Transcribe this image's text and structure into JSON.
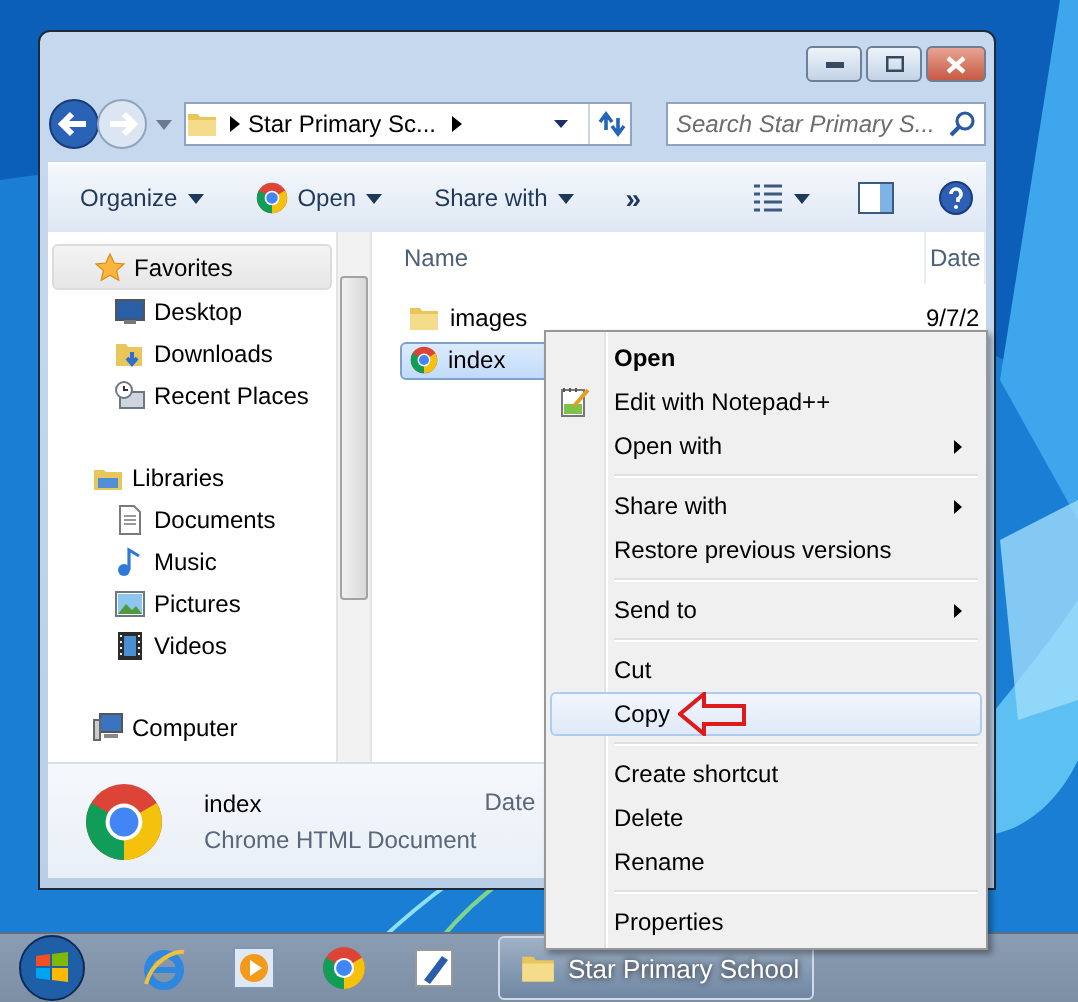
{
  "window": {
    "address": {
      "crumb": "Star Primary Sc..."
    },
    "search": {
      "placeholder": "Search Star Primary S..."
    },
    "toolbar": [
      {
        "label": "Organize",
        "kind": "menu"
      },
      {
        "label": "Open",
        "kind": "app-menu"
      },
      {
        "label": "Share with",
        "kind": "menu"
      },
      {
        "label": "»",
        "kind": "overflow"
      }
    ],
    "navigation": [
      {
        "label": "Favorites",
        "kind": "star",
        "selected": true,
        "children": [
          {
            "label": "Desktop",
            "kind": "desktop",
            "selected": false
          },
          {
            "label": "Downloads",
            "kind": "downloads",
            "selected": false
          },
          {
            "label": "Recent Places",
            "kind": "recent",
            "selected": false
          }
        ]
      },
      {
        "label": "Libraries",
        "kind": "library",
        "selected": false,
        "children": [
          {
            "label": "Documents",
            "kind": "document",
            "selected": false
          },
          {
            "label": "Music",
            "kind": "music",
            "selected": false
          },
          {
            "label": "Pictures",
            "kind": "pictures",
            "selected": false
          },
          {
            "label": "Videos",
            "kind": "videos",
            "selected": false
          }
        ]
      },
      {
        "label": "Computer",
        "kind": "computer",
        "selected": false
      }
    ],
    "columns": [
      "Name",
      "Date"
    ],
    "files": [
      {
        "name": "images",
        "kind": "folder",
        "date": "9/7/2",
        "selected": false
      },
      {
        "name": "index",
        "kind": "chrome",
        "selected": true
      }
    ],
    "details": {
      "name": "index",
      "type": "Chrome HTML Document",
      "field": "Date"
    }
  },
  "context_menu": [
    {
      "kind": "item",
      "label": "Open",
      "default": true,
      "icon": false,
      "submenu": false,
      "selected": false,
      "pointer_arrow": false
    },
    {
      "kind": "item",
      "label": "Edit with Notepad++",
      "default": false,
      "icon": true,
      "submenu": false,
      "selected": false,
      "pointer_arrow": false
    },
    {
      "kind": "item",
      "label": "Open with",
      "default": false,
      "icon": false,
      "submenu": true,
      "selected": false,
      "pointer_arrow": false
    },
    {
      "kind": "separator"
    },
    {
      "kind": "item",
      "label": "Share with",
      "default": false,
      "icon": false,
      "submenu": true,
      "selected": false,
      "pointer_arrow": false
    },
    {
      "kind": "item",
      "label": "Restore previous versions",
      "default": false,
      "icon": false,
      "submenu": false,
      "selected": false,
      "pointer_arrow": false
    },
    {
      "kind": "separator"
    },
    {
      "kind": "item",
      "label": "Send to",
      "default": false,
      "icon": false,
      "submenu": true,
      "selected": false,
      "pointer_arrow": false
    },
    {
      "kind": "separator"
    },
    {
      "kind": "item",
      "label": "Cut",
      "default": false,
      "icon": false,
      "submenu": false,
      "selected": false,
      "pointer_arrow": false
    },
    {
      "kind": "item",
      "label": "Copy",
      "default": false,
      "icon": false,
      "submenu": false,
      "selected": true,
      "pointer_arrow": true
    },
    {
      "kind": "separator"
    },
    {
      "kind": "item",
      "label": "Create shortcut",
      "default": false,
      "icon": false,
      "submenu": false,
      "selected": false,
      "pointer_arrow": false
    },
    {
      "kind": "item",
      "label": "Delete",
      "default": false,
      "icon": false,
      "submenu": false,
      "selected": false,
      "pointer_arrow": false
    },
    {
      "kind": "item",
      "label": "Rename",
      "default": false,
      "icon": false,
      "submenu": false,
      "selected": false,
      "pointer_arrow": false
    },
    {
      "kind": "separator"
    },
    {
      "kind": "item",
      "label": "Properties",
      "default": false,
      "icon": false,
      "submenu": false,
      "selected": false,
      "pointer_arrow": false
    }
  ],
  "taskbar": {
    "pinned": [
      {
        "kind": "browser-e"
      },
      {
        "kind": "media"
      },
      {
        "kind": "chrome"
      },
      {
        "kind": "pen"
      }
    ],
    "tasks": [
      {
        "label": "Star Primary School",
        "kind": "folder"
      }
    ]
  }
}
